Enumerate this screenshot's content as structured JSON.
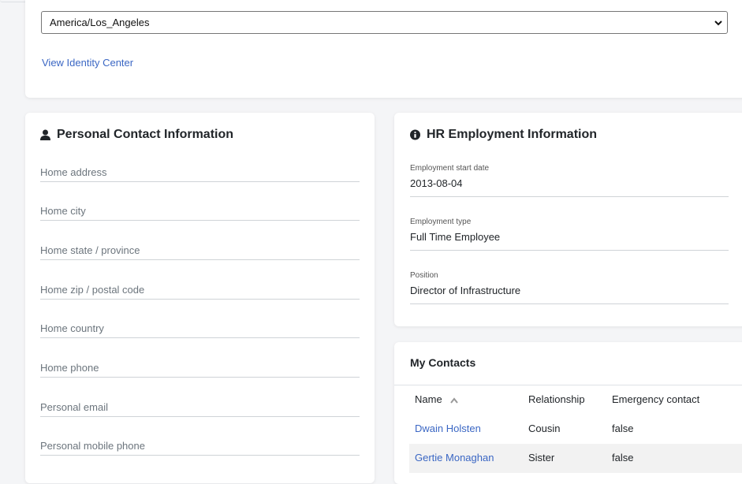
{
  "timezone": {
    "selected": "America/Los_Angeles"
  },
  "identity_link": "View Identity Center",
  "personal": {
    "title": "Personal Contact Information",
    "fields": [
      "Home address",
      "Home city",
      "Home state / province",
      "Home zip / postal code",
      "Home country",
      "Home phone",
      "Personal email",
      "Personal mobile phone"
    ]
  },
  "hr": {
    "title": "HR Employment Information",
    "fields": [
      {
        "label": "Employment start date",
        "value": "2013-08-04"
      },
      {
        "label": "Employment type",
        "value": "Full Time Employee"
      },
      {
        "label": "Position",
        "value": "Director of Infrastructure"
      }
    ]
  },
  "contacts": {
    "title": "My Contacts",
    "headers": {
      "name": "Name",
      "relationship": "Relationship",
      "emergency": "Emergency contact"
    },
    "rows": [
      {
        "name": "Dwain Holsten",
        "relationship": "Cousin",
        "emergency": "false"
      },
      {
        "name": "Gertie Monaghan",
        "relationship": "Sister",
        "emergency": "false"
      }
    ]
  },
  "colors": {
    "link": "#3b67c4",
    "card": "#ffffff",
    "page": "#f4f5f7"
  },
  "icons": {
    "personal": "user-icon",
    "hr": "info-circle-icon",
    "sort": "chevron-up-icon",
    "select": "chevron-down-icon"
  }
}
